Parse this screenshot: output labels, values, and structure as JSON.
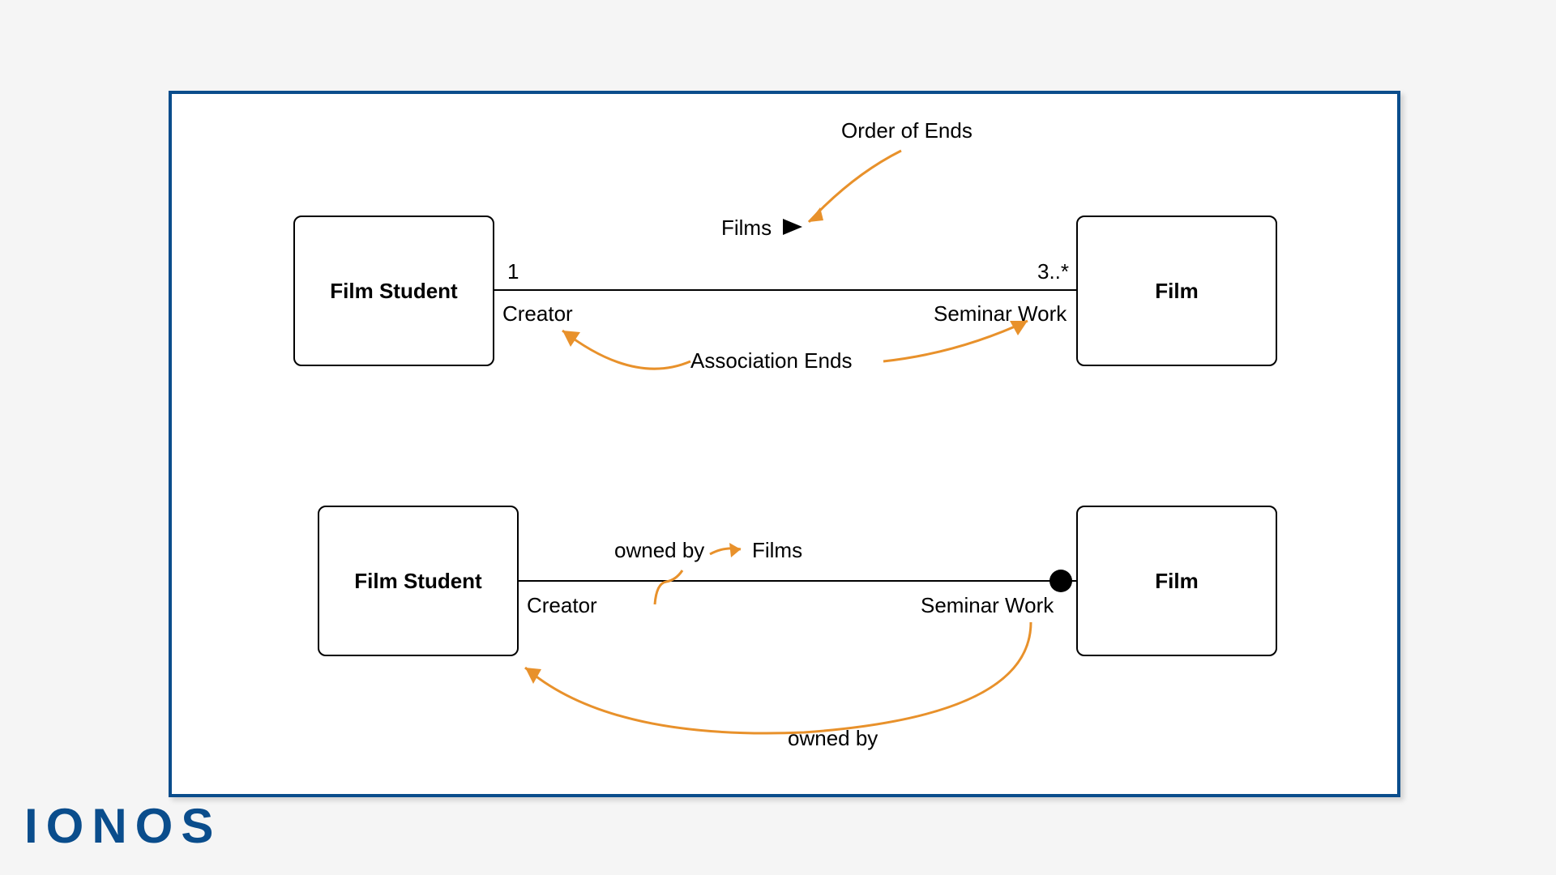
{
  "logo": "IONOS",
  "diagram1": {
    "leftClass": "Film Student",
    "rightClass": "Film",
    "assocName": "Films",
    "multLeft": "1",
    "multRight": "3..*",
    "roleLeft": "Creator",
    "roleRight": "Seminar Work",
    "annoTop": "Order of Ends",
    "annoMid": "Association Ends"
  },
  "diagram2": {
    "leftClass": "Film Student",
    "rightClass": "Film",
    "assocName": "Films",
    "roleLeft": "Creator",
    "roleRight": "Seminar Work",
    "ownedByLabel": "owned by",
    "ownedByBottom": "owned by"
  }
}
